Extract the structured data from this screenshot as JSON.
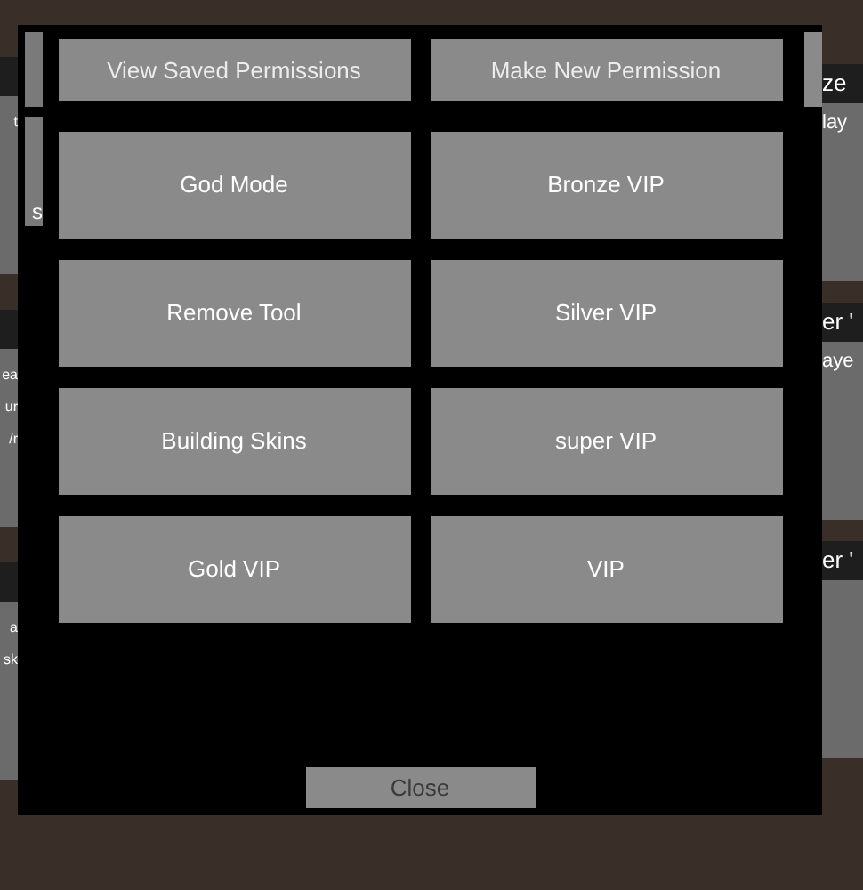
{
  "background": {
    "left_panels": [
      {
        "texts": [
          "t"
        ]
      },
      {
        "texts": [
          "ea",
          "ur",
          "/r"
        ]
      },
      {
        "texts": [
          "a",
          "sk"
        ]
      }
    ],
    "right_panels": [
      {
        "header": "ze",
        "texts": [
          "lay"
        ]
      },
      {
        "header": "er '",
        "texts": [
          "aye"
        ]
      },
      {
        "header": "er '"
      }
    ]
  },
  "modal": {
    "side_text": "s",
    "top_buttons": [
      "View Saved Permissions",
      "Make New Permission"
    ],
    "permissions": [
      "God Mode",
      "Bronze VIP",
      "Remove Tool",
      "Silver VIP",
      "Building Skins",
      "super VIP",
      "Gold VIP",
      "VIP"
    ],
    "close": "Close"
  }
}
